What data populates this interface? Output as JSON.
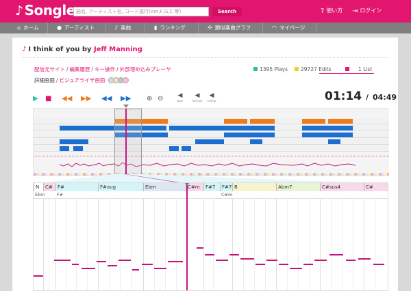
{
  "header": {
    "logo_text": "Songle",
    "search_placeholder": "曲名, アーティスト名, コード進行(Am,F,G,C 等)",
    "search_button": "Search",
    "help_label": "使い方",
    "login_label": "ログイン"
  },
  "nav": {
    "items": [
      {
        "label": "ホーム",
        "icon": "home-icon"
      },
      {
        "label": "アーティスト",
        "icon": "person-icon"
      },
      {
        "label": "楽曲",
        "icon": "music-note-icon"
      },
      {
        "label": "ランキング",
        "icon": "ranking-icon"
      },
      {
        "label": "類似楽曲グラフ",
        "icon": "graph-icon"
      },
      {
        "label": "マイページ",
        "icon": "headphones-icon"
      }
    ]
  },
  "song": {
    "title": "I think of you",
    "by": "by",
    "artist": "Jeff Manning"
  },
  "links": {
    "row1": [
      "配信元サイト",
      "編集履歴",
      "キー操作",
      "外部埋め込みプレーヤ"
    ],
    "row2_prefix": "詳細画面",
    "row2_link": "ビジュアライザ画面"
  },
  "stats": {
    "plays": "1395 Plays",
    "edits": "29727 Edits",
    "lists": "1 List",
    "colors": {
      "plays": "#2bbf92",
      "edits": "#f2cf2e",
      "lists": "#e2166e"
    }
  },
  "player": {
    "current_time": "01:14",
    "separator": "/",
    "total_time": "04:49",
    "small_buttons": [
      {
        "label": "BEAT",
        "icon": "speaker-icon"
      },
      {
        "label": "MELODY",
        "icon": "speaker-icon"
      },
      {
        "label": "CHORD",
        "icon": "speaker-icon"
      }
    ]
  },
  "chords": {
    "row1": [
      "N",
      "C#",
      "F#",
      "F#aug",
      "Ebm",
      "C#m",
      "F#7",
      "F#7",
      "B",
      "Abm7",
      "C#sus4",
      "C#"
    ],
    "row2": [
      "Ebm",
      "F#",
      "C#m"
    ]
  },
  "colors": {
    "brand": "#e2166e",
    "nav_bg": "#7f7f7f",
    "chorus": "#f07a18",
    "repeat": "#1c6fd0",
    "melody": "#c3127c"
  }
}
